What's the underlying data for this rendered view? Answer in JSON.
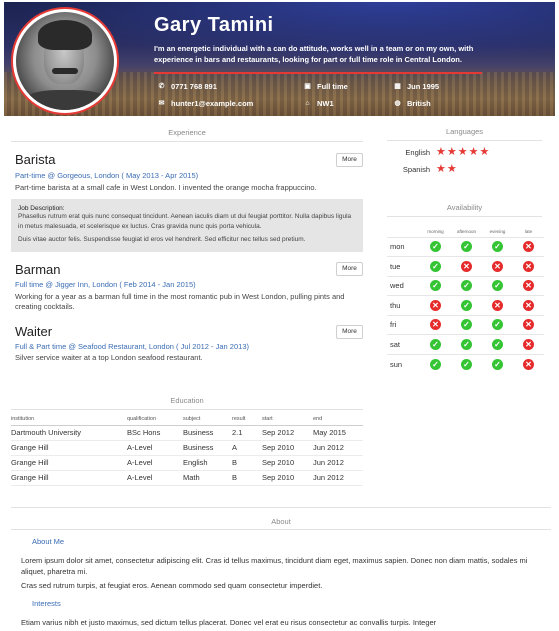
{
  "profile": {
    "name": "Gary Tamini",
    "tagline": "I'm an energetic individual with a can do attitude, works well in a team or on my own, with experience in bars and restaurants, looking for part or full time role in Central London.",
    "phone": "0771 768 891",
    "email": "hunter1@example.com",
    "job_type": "Full time",
    "postcode": "NW1",
    "date": "Jun 1995",
    "nationality": "British",
    "icons": {
      "phone": "phone-icon",
      "email": "envelope-icon",
      "job_type": "briefcase-icon",
      "postcode": "home-icon",
      "date": "calendar-icon",
      "nationality": "globe-icon"
    }
  },
  "experience": {
    "heading": "Experience",
    "jobs": [
      {
        "title": "Barista",
        "subtitle": "Part-time @ Gorgeous, London ( May 2013 - Apr 2015)",
        "desc": "Part-time barista at a small cafe in West London. I invented the orange mocha frappuccino.",
        "more": "More"
      },
      {
        "title": "Barman",
        "subtitle": "Full time @ Jigger Inn, London ( Feb 2014 - Jan 2015)",
        "desc": "Working for a year as a barman full time in the most romantic pub in West London, pulling pints and creating cocktails.",
        "more": "More"
      },
      {
        "title": "Waiter",
        "subtitle": "Full & Part time @ Seafood Restaurant, London ( Jul 2012 - Jan 2013)",
        "desc": "Silver service waiter at a top London seafood restaurant.",
        "more": "More"
      }
    ],
    "job_description": {
      "label": "Job Description:",
      "text1": "Phasellus rutrum erat quis nunc consequat tincidunt. Aenean iaculis diam ut dui feugiat porttitor. Nulla dapibus ligula in metus malesuada, et scelerisque ex luctus. Cras gravida nunc quis porta vehicula.",
      "text2": "Duis vitae auctor felis. Suspendisse feugiat id eros vel hendrerit. Sed efficitur nec tellus sed pretium."
    }
  },
  "languages": {
    "heading": "Languages",
    "items": [
      {
        "name": "English",
        "rating": 5,
        "stars": "★★★★★"
      },
      {
        "name": "Spanish",
        "rating": 2,
        "stars": "★★"
      }
    ]
  },
  "availability": {
    "heading": "Availability",
    "columns": [
      "morning",
      "afternoon",
      "evening",
      "late"
    ],
    "rows": [
      {
        "day": "mon",
        "values": [
          true,
          true,
          true,
          false
        ]
      },
      {
        "day": "tue",
        "values": [
          true,
          false,
          false,
          false
        ]
      },
      {
        "day": "wed",
        "values": [
          true,
          true,
          true,
          false
        ]
      },
      {
        "day": "thu",
        "values": [
          false,
          true,
          false,
          false
        ]
      },
      {
        "day": "fri",
        "values": [
          false,
          true,
          true,
          false
        ]
      },
      {
        "day": "sat",
        "values": [
          true,
          true,
          true,
          false
        ]
      },
      {
        "day": "sun",
        "values": [
          true,
          true,
          true,
          false
        ]
      }
    ],
    "icons": {
      "true": "check-icon",
      "false": "cross-icon"
    },
    "colors": {
      "true": "#34c434",
      "false": "#e52b2b"
    }
  },
  "education": {
    "heading": "Education",
    "columns": [
      "institution",
      "qualification",
      "subject",
      "result",
      "start",
      "end"
    ],
    "rows": [
      [
        "Dartmouth University",
        "BSc Hons",
        "Business",
        "2.1",
        "Sep 2012",
        "May 2015"
      ],
      [
        "Grange Hill",
        "A-Level",
        "Business",
        "A",
        "Sep 2010",
        "Jun 2012"
      ],
      [
        "Grange Hill",
        "A-Level",
        "English",
        "B",
        "Sep 2010",
        "Jun 2012"
      ],
      [
        "Grange Hill",
        "A-Level",
        "Math",
        "B",
        "Sep 2010",
        "Jun 2012"
      ]
    ]
  },
  "about": {
    "heading": "About",
    "about_me_label": "About Me",
    "about_me_p1": "Lorem ipsum dolor sit amet, consectetur adipiscing elit. Cras id tellus maximus, tincidunt diam eget, maximus sapien. Donec non diam mattis, sodales mi aliquet, pharetra mi.",
    "about_me_p2": "Cras sed rutrum turpis, at feugiat eros. Aenean commodo sed quam consectetur imperdiet.",
    "interests_label": "Interests",
    "interests_p1": "Etiam varius nibh et justo maximus, sed dictum tellus placerat. Donec vel erat eu risus consectetur ac convallis turpis. Integer"
  },
  "colors": {
    "accent": "#e53935",
    "link": "#3a6cb4"
  }
}
